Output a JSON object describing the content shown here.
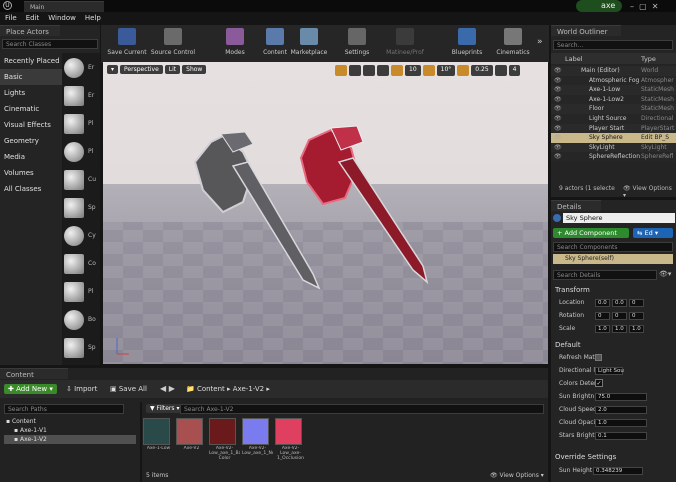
{
  "menubar": {
    "items": [
      "File",
      "Edit",
      "Window",
      "Help"
    ],
    "doc_tab": "Main",
    "user": "axe"
  },
  "place_actors": {
    "tab": "Place Actors",
    "search_placeholder": "Search Classes",
    "categories": [
      "Recently Placed",
      "Basic",
      "Lights",
      "Cinematic",
      "Visual Effects",
      "Geometry",
      "Media",
      "Volumes",
      "All Classes"
    ],
    "selected_category": "Basic",
    "items": [
      "Er",
      "Er",
      "Pl",
      "Pl",
      "Cu",
      "Sp",
      "Cy",
      "Co",
      "Pl",
      "Bo",
      "Sp"
    ]
  },
  "toolbar": {
    "buttons": [
      "Save Current",
      "Source Control",
      "Modes",
      "Content",
      "Marketplace",
      "Settings",
      "Matinee/Prof",
      "Blueprints",
      "Cinematics"
    ]
  },
  "viewport": {
    "perspective": "Perspective",
    "lit": "Lit",
    "show": "Show",
    "grid": "10",
    "angle": "10°",
    "scale": "0.25",
    "cam": "4"
  },
  "outliner": {
    "tab": "World Outliner",
    "search_placeholder": "Search...",
    "col_label": "Label",
    "col_type": "Type",
    "rows": [
      {
        "label": "Main (Editor)",
        "type": "World"
      },
      {
        "label": "Atmospheric Fog",
        "type": "Atmospher"
      },
      {
        "label": "Axe-1-Low",
        "type": "StaticMesh"
      },
      {
        "label": "Axe-1-Low2",
        "type": "StaticMesh"
      },
      {
        "label": "Floor",
        "type": "StaticMesh"
      },
      {
        "label": "Light Source",
        "type": "Directional"
      },
      {
        "label": "Player Start",
        "type": "PlayerStart"
      },
      {
        "label": "Sky Sphere",
        "type": "Edit BP_S"
      },
      {
        "label": "SkyLight",
        "type": "SkyLight"
      },
      {
        "label": "SphereReflection",
        "type": "SphereRefl"
      }
    ],
    "selected_row": "Sky Sphere",
    "footer": "9 actors (1 selecte",
    "view_options": "View Options"
  },
  "details": {
    "tab": "Details",
    "object_name": "Sky Sphere",
    "add_component": "+ Add Component",
    "edit_bp": "Ed",
    "search_components": "Search Components",
    "self_label": "Sky Sphere(self)",
    "search_details": "Search Details",
    "transform_header": "Transform",
    "transform": [
      {
        "label": "Location",
        "values": [
          "0.0",
          "0.0",
          "0"
        ]
      },
      {
        "label": "Rotation",
        "values": [
          "0",
          "0",
          "0"
        ]
      },
      {
        "label": "Scale",
        "values": [
          "1.0",
          "1.0",
          "1.0"
        ]
      }
    ],
    "default_header": "Default",
    "props": [
      {
        "label": "Refresh Mat",
        "value": ""
      },
      {
        "label": "Directional l",
        "value": "Light Sou"
      },
      {
        "label": "Colors Deter",
        "value": "✓"
      },
      {
        "label": "Sun Brightn",
        "value": "75.0"
      },
      {
        "label": "Cloud Speed",
        "value": "2.0"
      },
      {
        "label": "Cloud Opaci",
        "value": "1.0"
      },
      {
        "label": "Stars Bright",
        "value": "0.1"
      }
    ],
    "override_header": "Override Settings",
    "sun_height_label": "Sun Height",
    "sun_height": "0.348239"
  },
  "content_browser": {
    "tab": "Content Browser",
    "add_new": "Add New",
    "import": "Import",
    "save_all": "Save All",
    "path": [
      "Content",
      "Axe-1-V2"
    ],
    "search_paths": "Search Paths",
    "filters": "Filters",
    "search_assets": "Search Axe-1-V2",
    "tree": [
      "Content",
      "Axe-1-V1",
      "Axe-1-V2"
    ],
    "selected_tree": "Axe-1-V2",
    "assets": [
      {
        "name": "Axe-1-Low",
        "color": "#2a4a4a"
      },
      {
        "name": "Axe-V2",
        "color": "#a85050"
      },
      {
        "name": "Axe-V2-Low_axe_1_Base Color",
        "color": "#6a1a1a"
      },
      {
        "name": "Axe-V2-Low_axe_1_Normal",
        "color": "#7b7bf0"
      },
      {
        "name": "Axe-V2-Low_axe-1_Occlusion",
        "color": "#e04060"
      }
    ],
    "count": "5 items",
    "view_options": "View Options"
  }
}
